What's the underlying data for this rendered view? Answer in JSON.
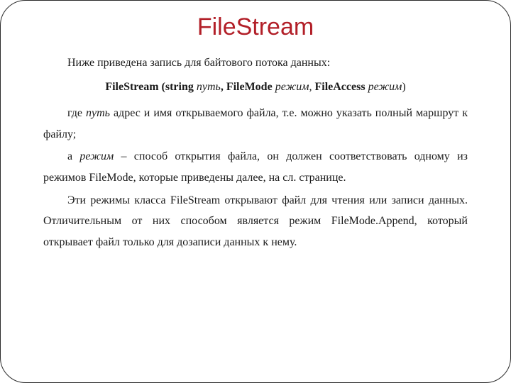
{
  "title": "FileStream",
  "intro": "Ниже приведена запись для байтового потока данных:",
  "signature": {
    "s1": "FileStream (string ",
    "i1": "путь",
    "s2": ", FileMode ",
    "i2": "режим,",
    "s3": " FileAccess ",
    "i3": "режим",
    "s4": ")"
  },
  "p2": {
    "t1": "где ",
    "i1": "путь",
    "t2": " адрес и имя открываемого файла, т.е. можно указать полный маршрут к файлу;"
  },
  "p3": {
    "t1": "а ",
    "i1": "режим",
    "t2": " – способ открытия файла, он должен соответствовать одному из режимов FileMode, которые приведены далее, на сл. странице."
  },
  "p4": "Эти режимы класса FileStream открывают файл для чтения или записи данных. Отличительным от них способом является режим FileMode.Append, который открывает файл только для дозаписи данных к нему."
}
